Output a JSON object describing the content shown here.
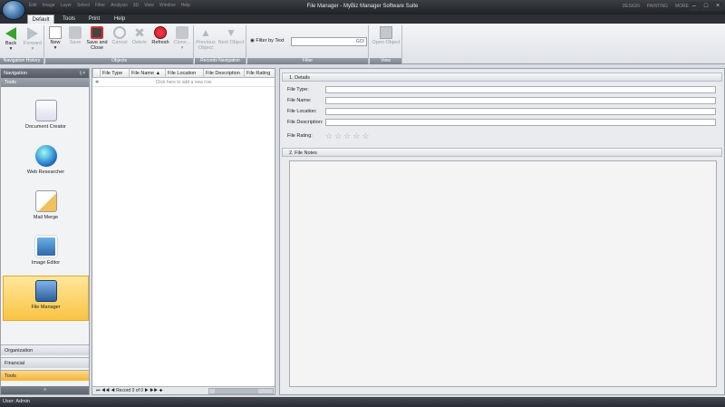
{
  "app": {
    "title": "File Manager - MyBiz Manager Software Suite",
    "qat_items": [
      "Edit",
      "Image",
      "Layer",
      "Select",
      "Filter",
      "Analysis",
      "3D",
      "View",
      "Window",
      "Help"
    ],
    "title_right": [
      "DESIGN",
      "PAINTING",
      "MORE"
    ]
  },
  "tabs": [
    {
      "label": "Default",
      "active": true
    },
    {
      "label": "Tools",
      "active": false
    },
    {
      "label": "Print",
      "active": false
    },
    {
      "label": "Help",
      "active": false
    }
  ],
  "ribbon": {
    "groups": {
      "nav_history": "Navigation History",
      "objects": "Objects",
      "records_nav": "Records Navigation",
      "filter": "Filter",
      "view": "View"
    },
    "buttons": {
      "back": "Back",
      "forward": "Forward",
      "new": "New",
      "save": "Save",
      "save_close_1": "Save and",
      "save_close_2": "Close",
      "cancel": "Cancel",
      "delete": "Delete",
      "refresh": "Refresh",
      "clone": "Clone...",
      "prev_obj_1": "Previous",
      "prev_obj_2": "Object",
      "next_obj": "Next Object",
      "filter_label": "Filter by Text",
      "go": "GO!",
      "open_obj": "Open Object"
    }
  },
  "navigation": {
    "header": "Navigation",
    "header_ctrl": "ţ ×",
    "sub": "Tools",
    "tools": [
      {
        "label": "Document Creator",
        "icon": "document-creator-icon",
        "selected": false
      },
      {
        "label": "Web Researcher",
        "icon": "globe-icon",
        "selected": false
      },
      {
        "label": "Mail Merge",
        "icon": "mail-merge-icon",
        "selected": false
      },
      {
        "label": "Image Editor",
        "icon": "image-editor-icon",
        "selected": false
      },
      {
        "label": "File Manager",
        "icon": "file-manager-icon",
        "selected": true
      }
    ],
    "sections": [
      {
        "label": "Organization",
        "active": false
      },
      {
        "label": "Financial",
        "active": false
      },
      {
        "label": "Tools",
        "active": true
      }
    ]
  },
  "grid": {
    "columns": [
      "File Type",
      "File Name",
      "File Location",
      "File Description",
      "File Rating"
    ],
    "sort_column": "File Name",
    "new_row_text": "Click here to add a new row",
    "record_text": "Record 0 of 0"
  },
  "details": {
    "section1": "1. Details",
    "fields": [
      {
        "label": "File Type:",
        "value": ""
      },
      {
        "label": "File Name:",
        "value": ""
      },
      {
        "label": "File Location:",
        "value": ""
      },
      {
        "label": "File Description:",
        "value": ""
      }
    ],
    "rating_label": "File Rating:",
    "rating": 0,
    "rating_max": 5,
    "section2": "2. File Notes",
    "notes": ""
  },
  "status": {
    "user": "User: Admin"
  },
  "colors": {
    "accent_selected": "#f9c443",
    "back_arrow": "#3aa12e",
    "refresh": "#d12a2a"
  }
}
